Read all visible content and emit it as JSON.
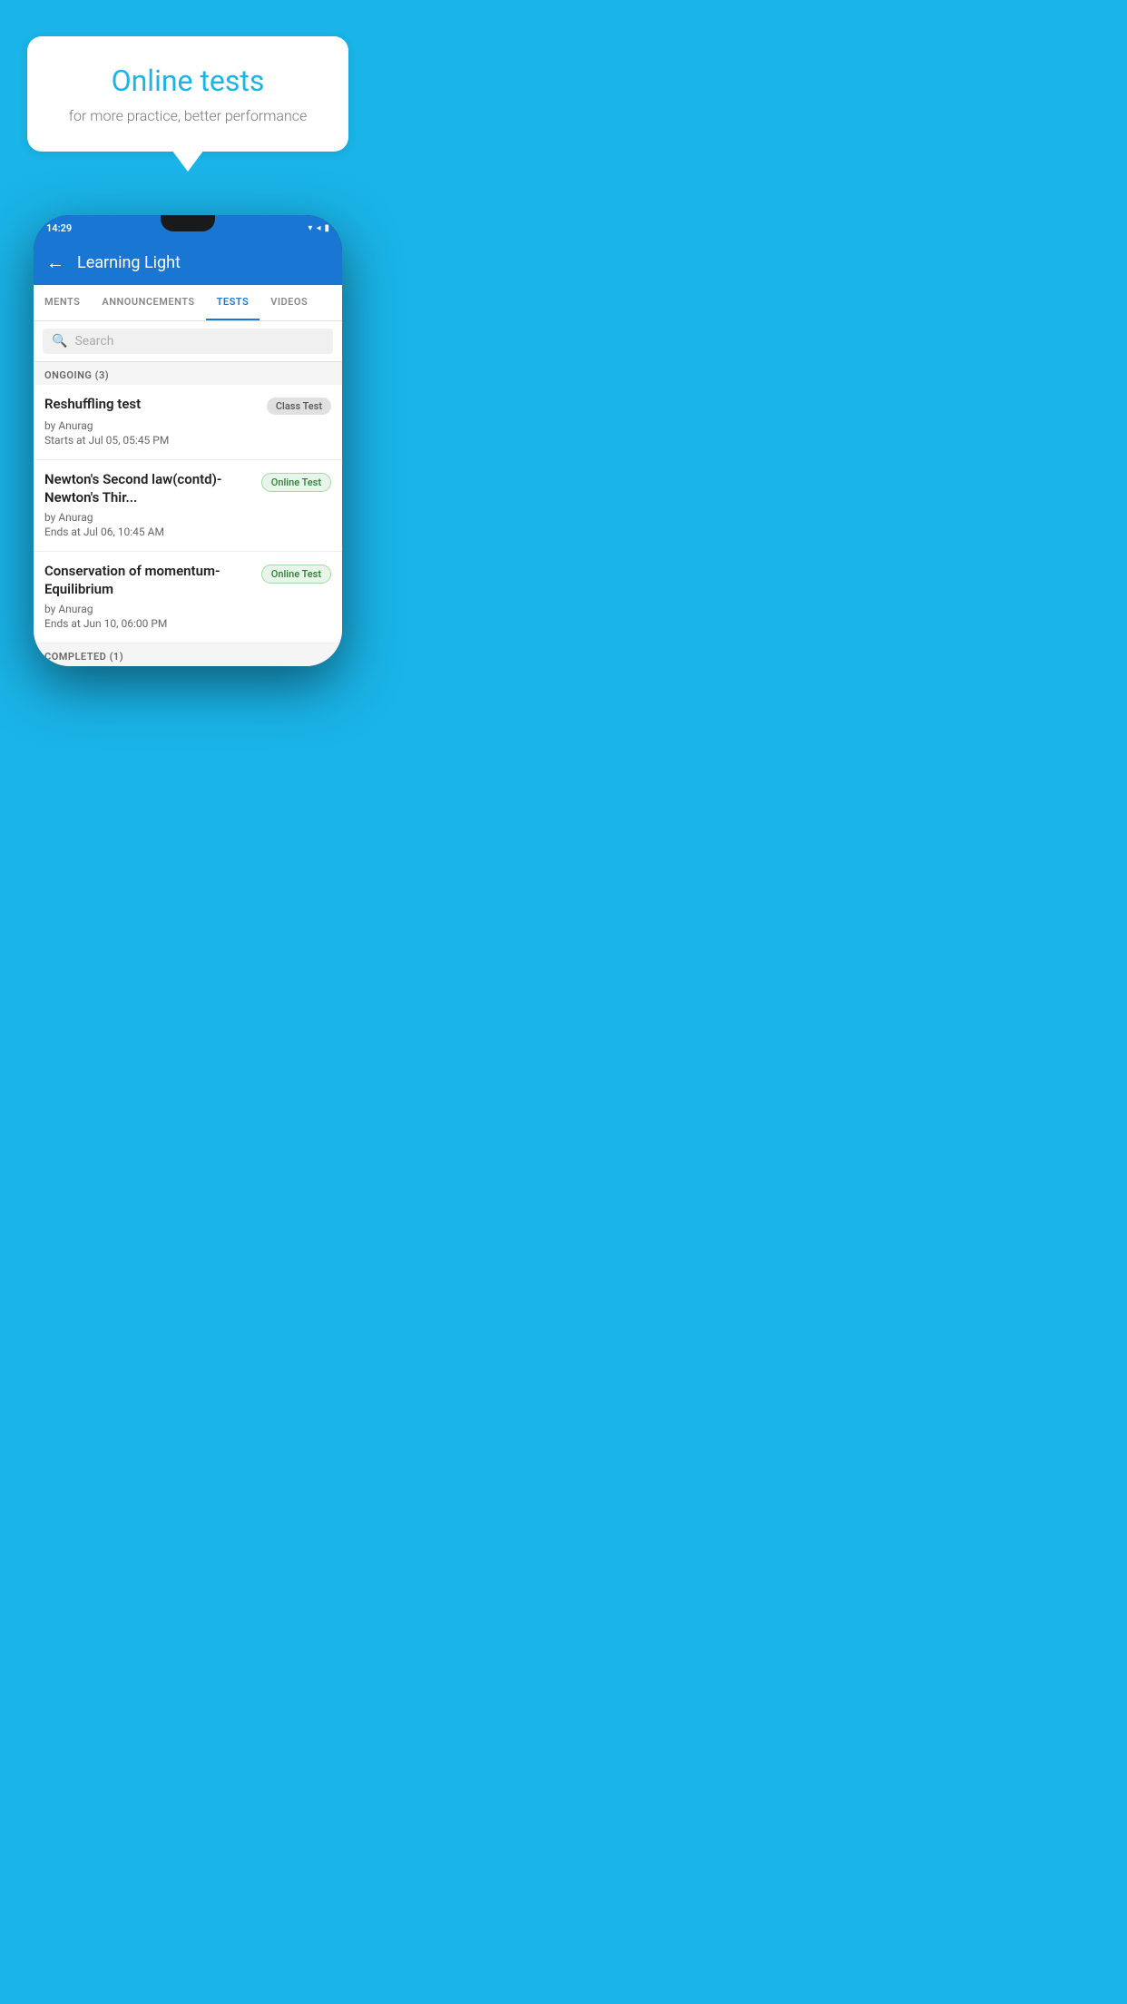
{
  "background_color": "#1ab4e8",
  "speech_bubble": {
    "title": "Online tests",
    "subtitle": "for more practice, better performance"
  },
  "phone": {
    "status_bar": {
      "time": "14:29",
      "icons": [
        "▼",
        "◀",
        "▮"
      ]
    },
    "app_header": {
      "back_label": "←",
      "title": "Learning Light"
    },
    "tabs": [
      {
        "label": "MENTS",
        "active": false
      },
      {
        "label": "ANNOUNCEMENTS",
        "active": false
      },
      {
        "label": "TESTS",
        "active": true
      },
      {
        "label": "VIDEOS",
        "active": false
      }
    ],
    "search": {
      "placeholder": "Search"
    },
    "sections": [
      {
        "header": "ONGOING (3)",
        "items": [
          {
            "title": "Reshuffling test",
            "badge": "Class Test",
            "badge_type": "class",
            "author": "by Anurag",
            "date": "Starts at  Jul 05, 05:45 PM"
          },
          {
            "title": "Newton's Second law(contd)-Newton's Thir...",
            "badge": "Online Test",
            "badge_type": "online",
            "author": "by Anurag",
            "date": "Ends at  Jul 06, 10:45 AM"
          },
          {
            "title": "Conservation of momentum-Equilibrium",
            "badge": "Online Test",
            "badge_type": "online",
            "author": "by Anurag",
            "date": "Ends at  Jun 10, 06:00 PM"
          }
        ]
      }
    ],
    "completed_header": "COMPLETED (1)"
  }
}
